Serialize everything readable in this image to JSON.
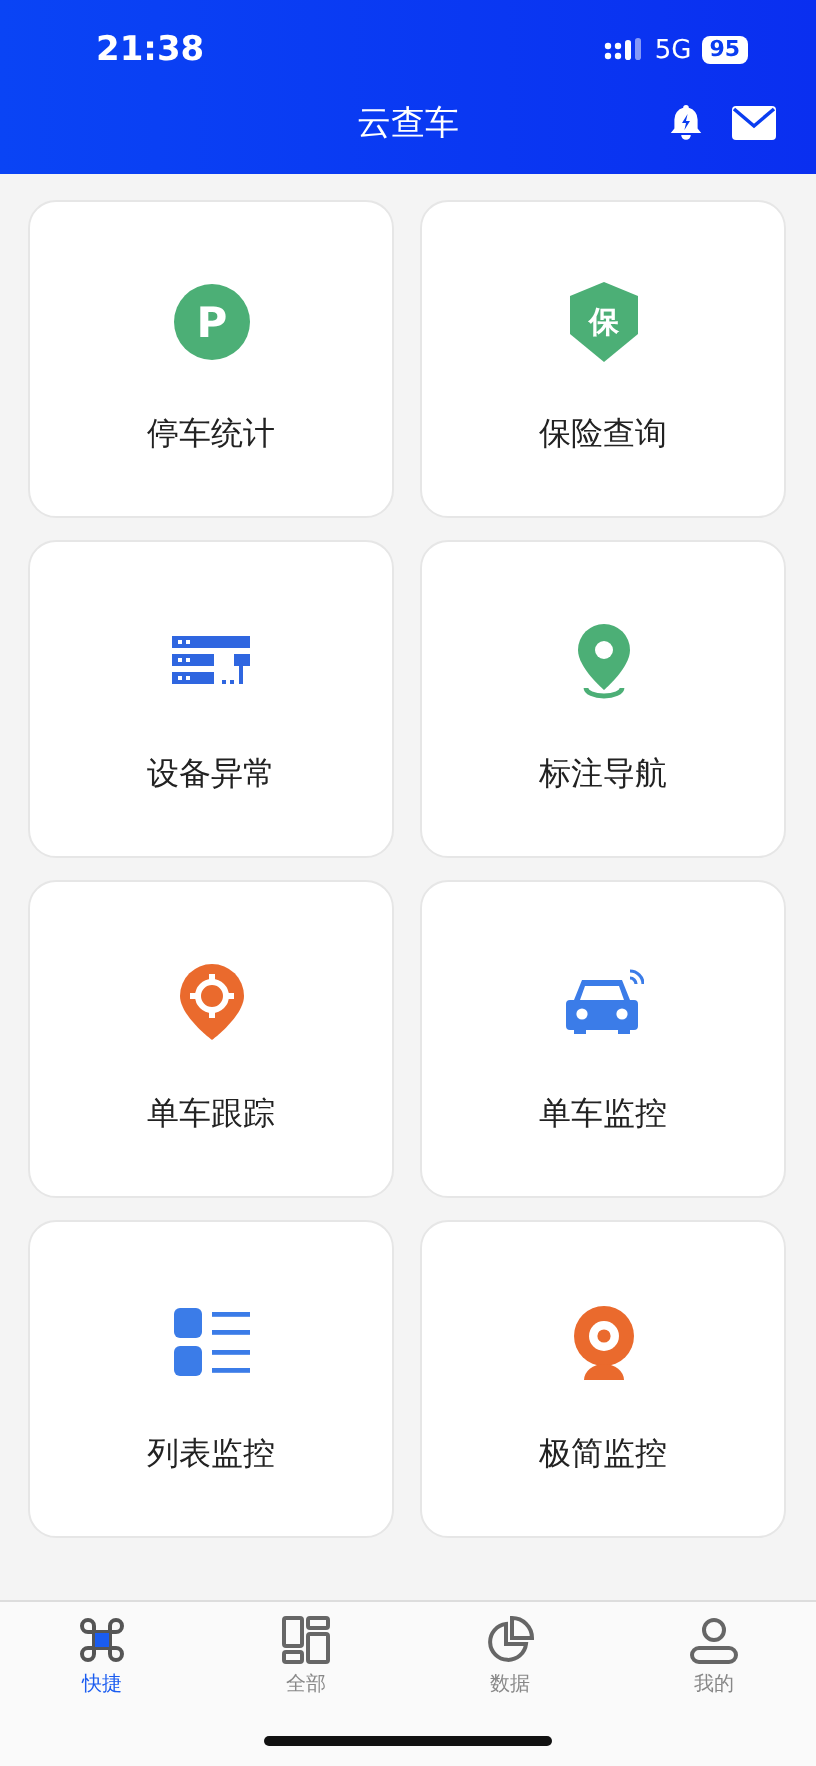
{
  "status_bar": {
    "time": "21:38",
    "network": "5G",
    "battery": "95"
  },
  "header": {
    "title": "云查车"
  },
  "tiles": [
    {
      "label": "停车统计",
      "kind": "parking",
      "icon_text": "P"
    },
    {
      "label": "保险查询",
      "kind": "shield",
      "icon_text": "保"
    },
    {
      "label": "设备异常",
      "kind": "server"
    },
    {
      "label": "标注导航",
      "kind": "pin"
    },
    {
      "label": "单车跟踪",
      "kind": "target"
    },
    {
      "label": "单车监控",
      "kind": "car"
    },
    {
      "label": "列表监控",
      "kind": "list"
    },
    {
      "label": "极简监控",
      "kind": "webcam"
    }
  ],
  "tab_bar": [
    {
      "label": "快捷",
      "kind": "command",
      "selected": true
    },
    {
      "label": "全部",
      "kind": "grid",
      "selected": false
    },
    {
      "label": "数据",
      "kind": "pie",
      "selected": false
    },
    {
      "label": "我的",
      "kind": "person",
      "selected": false
    }
  ]
}
